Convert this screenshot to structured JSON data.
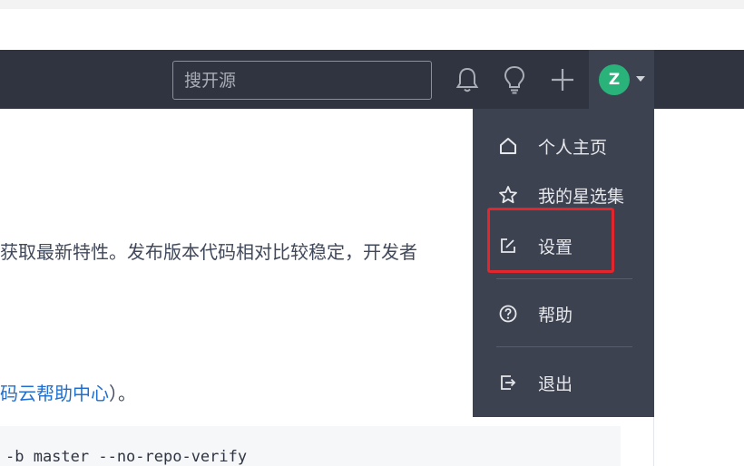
{
  "navbar": {
    "search_placeholder": "搜开源",
    "avatar_initial": "Z"
  },
  "icons": {
    "bell": "bell-icon",
    "bulb": "lightbulb-icon",
    "plus": "plus-icon",
    "caret": "caret-down-icon"
  },
  "content": {
    "line1": "获取最新特性。发布版本代码相对比较稳定，开发者",
    "line2_link": "码云帮助中心",
    "line2_suffix": "）。",
    "code": "-b master --no-repo-verify"
  },
  "dropdown": {
    "items": [
      {
        "label": "个人主页",
        "icon": "home-icon"
      },
      {
        "label": "我的星选集",
        "icon": "star-icon"
      },
      {
        "label": "设置",
        "icon": "edit-icon"
      },
      {
        "label": "帮助",
        "icon": "help-circle-icon"
      },
      {
        "label": "退出",
        "icon": "logout-icon"
      }
    ]
  },
  "colors": {
    "navbar_bg": "#2f3440",
    "dropdown_bg": "#3d4250",
    "avatar_bg": "#2ab27b",
    "link": "#1f6fd1",
    "highlight": "#e3262d"
  }
}
